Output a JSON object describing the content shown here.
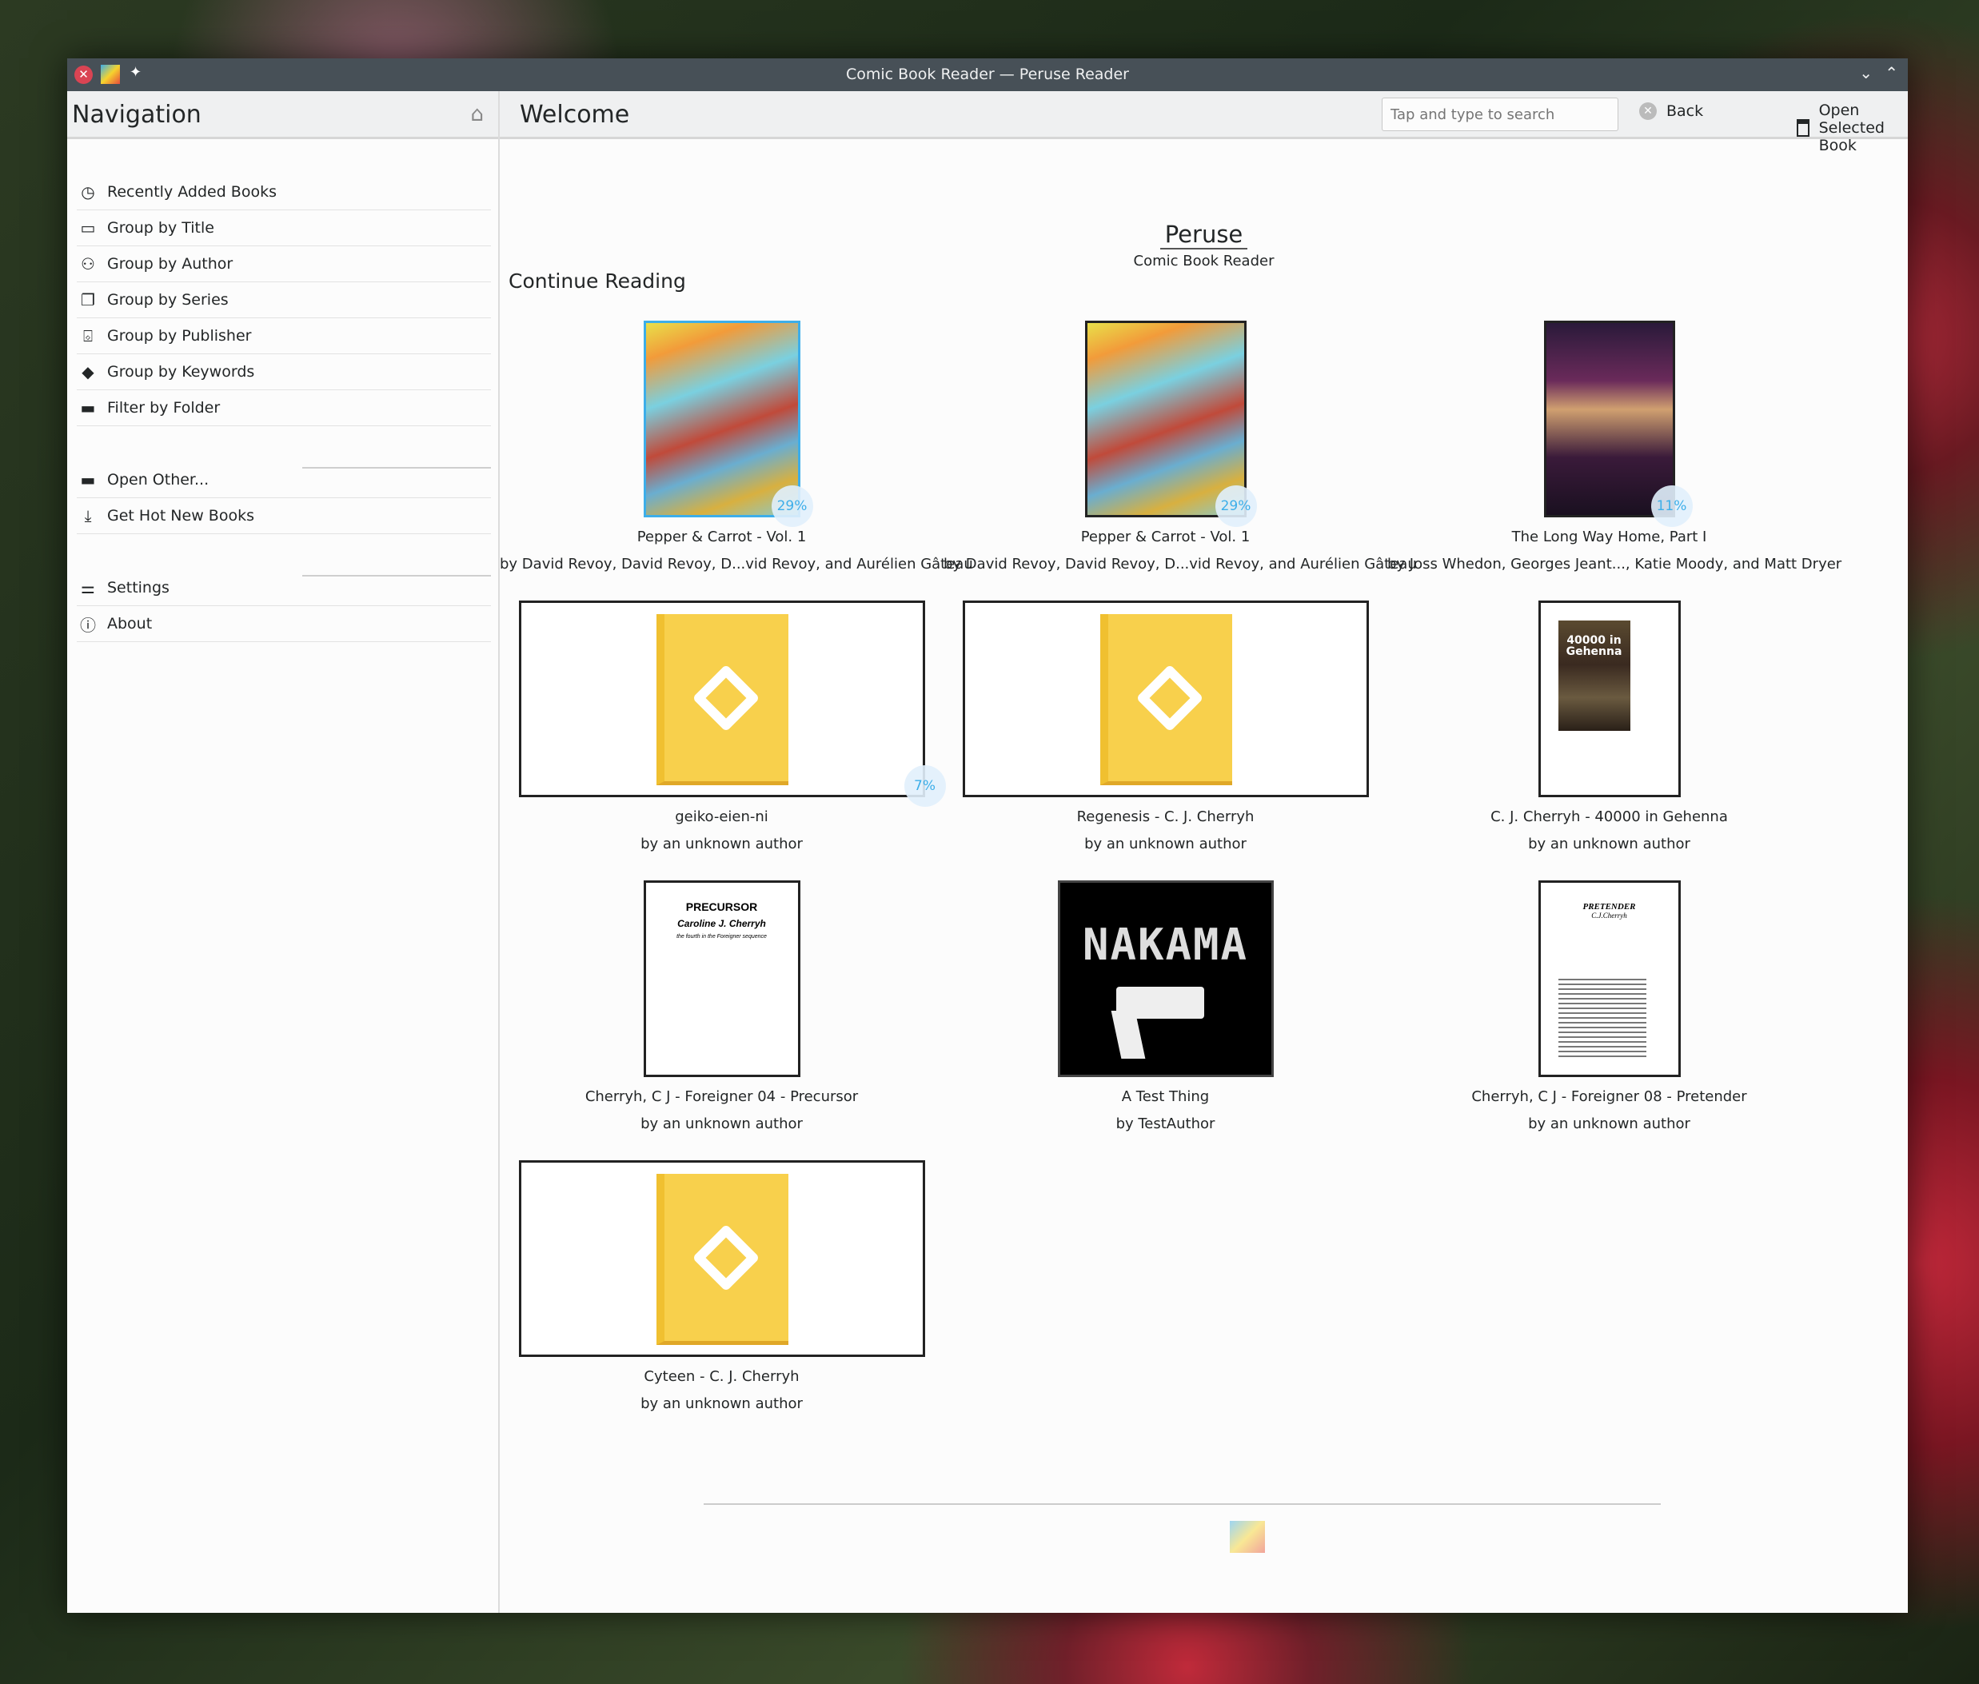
{
  "window": {
    "title": "Comic Book Reader — Peruse Reader"
  },
  "sidebar": {
    "title": "Navigation",
    "items": [
      {
        "label": "Recently Added Books",
        "icon": "clock-icon"
      },
      {
        "label": "Group by Title",
        "icon": "book-icon"
      },
      {
        "label": "Group by Author",
        "icon": "user-icon"
      },
      {
        "label": "Group by Series",
        "icon": "series-icon"
      },
      {
        "label": "Group by Publisher",
        "icon": "bag-icon"
      },
      {
        "label": "Group by Keywords",
        "icon": "tag-icon"
      },
      {
        "label": "Filter by Folder",
        "icon": "folder-icon"
      },
      {
        "label": "Open Other...",
        "icon": "folder-icon"
      },
      {
        "label": "Get Hot New Books",
        "icon": "download-icon"
      },
      {
        "label": "Settings",
        "icon": "settings-icon"
      },
      {
        "label": "About",
        "icon": "info-icon"
      }
    ]
  },
  "header": {
    "title": "Welcome",
    "search_placeholder": "Tap and type to search",
    "back_label": "Back",
    "open_label": "Open Selected Book"
  },
  "brand": {
    "name": "Peruse",
    "subtitle": "Comic Book Reader"
  },
  "section_title": "Continue Reading",
  "accent": "#3daee9",
  "books": [
    {
      "title": "Pepper & Carrot - Vol. 1",
      "author": "by David Revoy, David Revoy, D...vid Revoy, and Aurélien Gâteau",
      "progress": "29%",
      "cover": "pepper",
      "selected": true
    },
    {
      "title": "Pepper & Carrot - Vol. 1",
      "author": "by David Revoy, David Revoy, D...vid Revoy, and Aurélien Gâteau",
      "progress": "29%",
      "cover": "pepper"
    },
    {
      "title": "The Long Way Home, Part I",
      "author": "by Joss Whedon, Georges Jeant..., Katie Moody, and Matt Dryer",
      "progress": "11%",
      "cover": "buffy"
    },
    {
      "title": "geiko-eien-ni",
      "author": "by an unknown author",
      "progress": "7%",
      "cover": "epub"
    },
    {
      "title": "Regenesis - C. J. Cherryh",
      "author": "by an unknown author",
      "cover": "epub"
    },
    {
      "title": "C. J. Cherryh - 40000 in Gehenna",
      "author": "by an unknown author",
      "cover": "gehenna",
      "cover_text": "40000 in Gehenna"
    },
    {
      "title": "Cherryh, C J - Foreigner 04 - Precursor",
      "author": "by an unknown author",
      "cover": "precursor",
      "cover_text": [
        "PRECURSOR",
        "Caroline J. Cherryh",
        "the fourth in the Foreigner sequence"
      ]
    },
    {
      "title": "A Test Thing",
      "author": "by TestAuthor",
      "cover": "nakama",
      "cover_text": "NAKAMA"
    },
    {
      "title": "Cherryh, C J - Foreigner 08 - Pretender",
      "author": "by an unknown author",
      "cover": "pretender",
      "cover_text": [
        "PRETENDER",
        "C.J.Cherryh"
      ]
    },
    {
      "title": "Cyteen - C. J. Cherryh",
      "author": "by an unknown author",
      "cover": "epub"
    }
  ]
}
